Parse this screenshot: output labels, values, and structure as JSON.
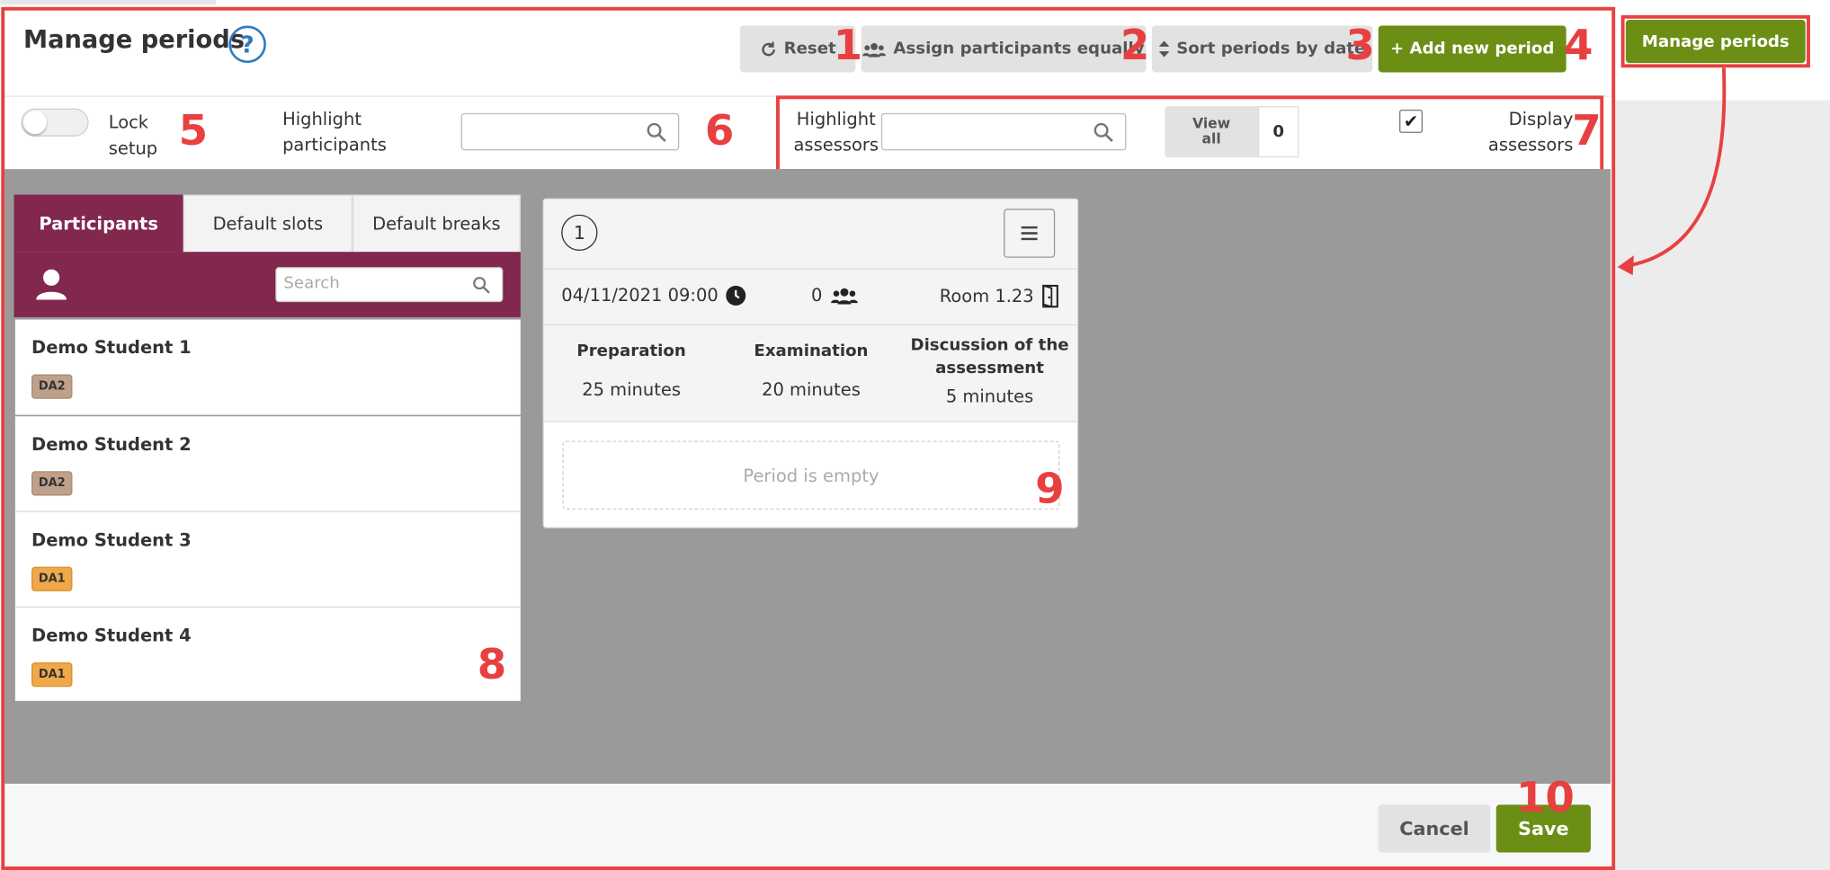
{
  "header": {
    "title": "Manage periods",
    "help_symbol": "?",
    "buttons": {
      "reset": "Reset",
      "assign": "Assign participants equally",
      "sort": "Sort periods by date",
      "add": "+ Add new period"
    },
    "side_button": "Manage periods"
  },
  "filters": {
    "lock_label_1": "Lock",
    "lock_label_2": "setup",
    "highlight_participants_1": "Highlight",
    "highlight_participants_2": "participants",
    "highlight_assessors_1": "Highlight",
    "highlight_assessors_2": "assessors",
    "view_all_1": "View",
    "view_all_2": "all",
    "view_count": "0",
    "display_assessors_1": "Display",
    "display_assessors_2": "assessors",
    "checkmark": "✔"
  },
  "tabs": [
    "Participants",
    "Default slots",
    "Default breaks"
  ],
  "participant_search_placeholder": "Search",
  "participants": [
    {
      "name": "Demo Student 1",
      "badge": "DA2"
    },
    {
      "name": "Demo Student 2",
      "badge": "DA2"
    },
    {
      "name": "Demo Student 3",
      "badge": "DA1"
    },
    {
      "name": "Demo Student 4",
      "badge": "DA1"
    }
  ],
  "period": {
    "number": "1",
    "datetime": "04/11/2021 09:00",
    "participants_count": "0",
    "room": "Room 1.23",
    "categories": [
      {
        "title": "Preparation",
        "value": "25 minutes"
      },
      {
        "title": "Examination",
        "value": "20 minutes"
      },
      {
        "title_1": "Discussion of the",
        "title_2": "assessment",
        "value": "5 minutes"
      }
    ],
    "empty_text": "Period is empty"
  },
  "footer": {
    "cancel": "Cancel",
    "save": "Save"
  },
  "annotations": [
    "1",
    "2",
    "3",
    "4",
    "5",
    "6",
    "7",
    "8",
    "9",
    "10"
  ],
  "colors": {
    "accent_green": "#6b8e14",
    "plum": "#82274e",
    "annotation_red": "#e84040"
  }
}
